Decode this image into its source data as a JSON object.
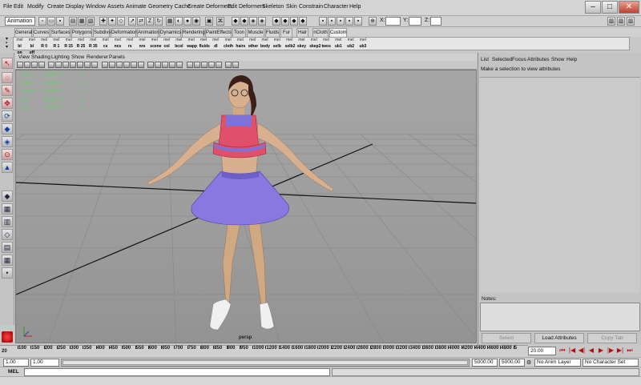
{
  "menubar": {
    "items": [
      "File",
      "Edit",
      "Modify",
      "Create",
      "Display",
      "Window",
      "Assets",
      "Animate",
      "Geometry Cache",
      "Create Deformers",
      "Edit Deformers",
      "Skeleton",
      "Skin",
      "Constrain",
      "Character",
      "Help"
    ],
    "window_controls": [
      "–",
      "□",
      "✕"
    ]
  },
  "statusline": {
    "menuset": "Animation",
    "x_label": "X:",
    "y_label": "Y:",
    "z_label": "Z:"
  },
  "shelf_tabs": {
    "items": [
      "General",
      "Curves",
      "Surfaces",
      "Polygons",
      "Subdivs",
      "Deformation",
      "Animation",
      "Dynamics",
      "Rendering",
      "PaintEffects",
      "Toon",
      "Muscle",
      "Fluids",
      "Fur",
      "Hair",
      "nCloth",
      "Custom"
    ],
    "active": "Custom"
  },
  "shelf": {
    "buttons": [
      {
        "icon": "mel",
        "label": "bl on"
      },
      {
        "icon": "mel",
        "label": "bl off"
      },
      {
        "icon": "mel",
        "label": "R 0"
      },
      {
        "icon": "mel",
        "label": "R 1"
      },
      {
        "icon": "mel",
        "label": "R 15"
      },
      {
        "icon": "mel",
        "label": "R 25"
      },
      {
        "icon": "mel",
        "label": "R 35"
      },
      {
        "icon": "mel",
        "label": "cs"
      },
      {
        "icon": "mel",
        "label": "ncs"
      },
      {
        "icon": "mel",
        "label": "rs"
      },
      {
        "icon": "mel",
        "label": "nrs"
      },
      {
        "icon": "mel",
        "label": "scene"
      },
      {
        "icon": "mel",
        "label": "col"
      },
      {
        "icon": "mel",
        "label": "bcol"
      },
      {
        "icon": "mel",
        "label": "wapp"
      },
      {
        "icon": "mel",
        "label": "fluids"
      },
      {
        "icon": "mel",
        "label": "dl"
      },
      {
        "icon": "mel",
        "label": "cloth"
      },
      {
        "icon": "mel",
        "label": "hairs"
      },
      {
        "icon": "mel",
        "label": "other"
      },
      {
        "icon": "mel",
        "label": "body"
      },
      {
        "icon": "mel",
        "label": "selb"
      },
      {
        "icon": "mel",
        "label": "selb2"
      },
      {
        "icon": "mel",
        "label": "skey"
      },
      {
        "icon": "mel",
        "label": "skep2"
      },
      {
        "icon": "mel",
        "label": "twos"
      },
      {
        "icon": "mel",
        "label": "ub1"
      },
      {
        "icon": "mel",
        "label": "ub2"
      },
      {
        "icon": "mel",
        "label": "ub3"
      }
    ]
  },
  "panel_menu": {
    "items": [
      "View",
      "Shading",
      "Lighting",
      "Show",
      "Renderer",
      "Panels"
    ]
  },
  "hud": {
    "rows": [
      {
        "label": "Verts:",
        "value": "112682",
        "sel": "0",
        "comp": "0"
      },
      {
        "label": "Edges:",
        "value": "416918",
        "sel": "0",
        "comp": "0"
      },
      {
        "label": "Faces:",
        "value": "223428",
        "sel": "0",
        "comp": "0"
      },
      {
        "label": "Tris:",
        "value": "391052",
        "sel": "0",
        "comp": "0"
      },
      {
        "label": "UVs:",
        "value": "472679",
        "sel": "0",
        "comp": "0"
      }
    ]
  },
  "viewport": {
    "camera_label": "persp"
  },
  "channel_box": {
    "menu": [
      "List",
      "Selected",
      "Focus",
      "Attributes",
      "Show",
      "Help"
    ],
    "message": "Make a selection to view attributes",
    "notes_label": "Notes:",
    "buttons": {
      "select": "Select",
      "load": "Load Attributes",
      "copy": "Copy Tab"
    }
  },
  "timeline": {
    "ticks": [
      "20",
      "100",
      "150",
      "200",
      "250",
      "300",
      "350",
      "400",
      "450",
      "500",
      "550",
      "600",
      "650",
      "700",
      "750",
      "800",
      "850",
      "900",
      "950",
      "1000",
      "1200",
      "1400",
      "1600",
      "1800",
      "2000",
      "2200",
      "2400",
      "2600",
      "2800",
      "3000",
      "3200",
      "3400",
      "3600",
      "3800",
      "4000",
      "4200",
      "4400",
      "4600",
      "4800",
      "5"
    ],
    "current_frame": "20.00"
  },
  "range": {
    "start": "1.00",
    "playback_start": "1.00",
    "playback_end": "5000.00",
    "end": "5000.00",
    "anim_layer": "No Anim Layer",
    "character_set": "No Character Set"
  },
  "command_line": {
    "label": "MEL"
  },
  "colors": {
    "hud_text": "#6ec870",
    "top": "#e0506a",
    "skirt": "#7e72d8",
    "skin": "#d8b090",
    "viewport_bg": "#a0a0a0"
  }
}
